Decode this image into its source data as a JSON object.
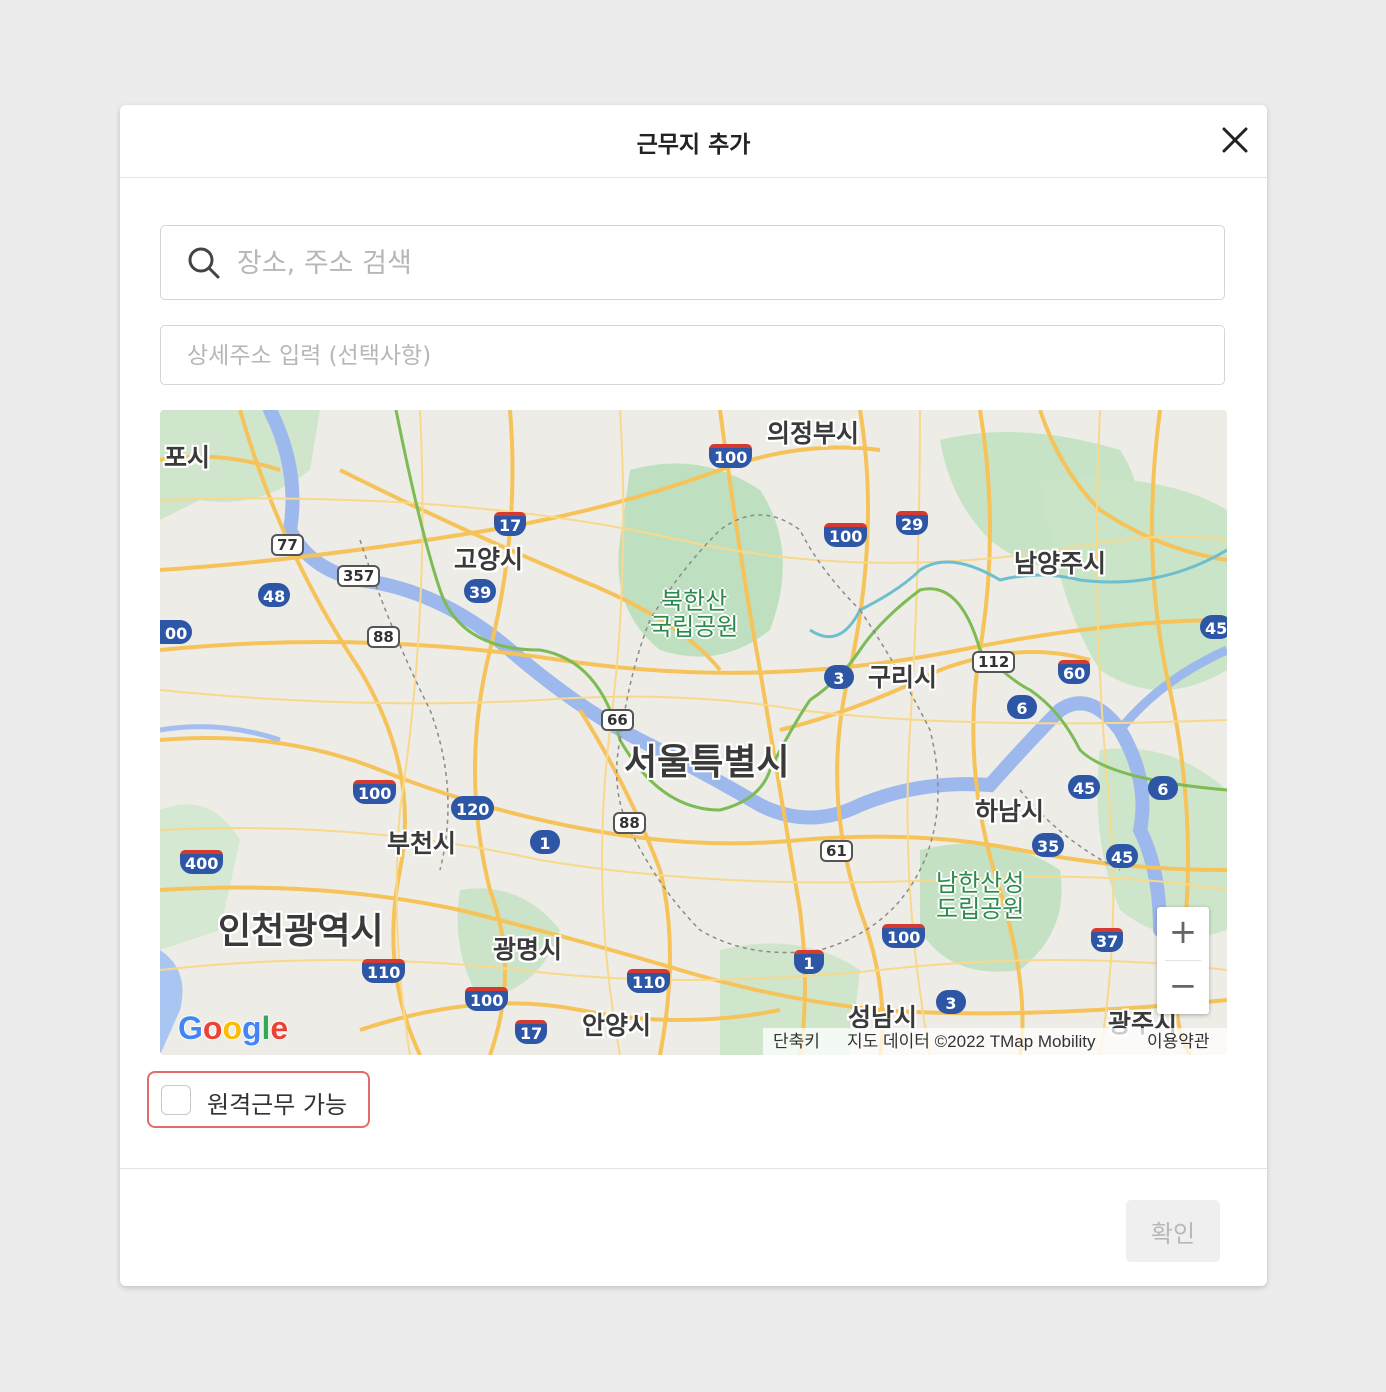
{
  "modal": {
    "title": "근무지 추가",
    "close_icon": "close-icon"
  },
  "search": {
    "icon": "search-icon",
    "placeholder": "장소, 주소 검색",
    "value": ""
  },
  "detail_address": {
    "placeholder": "상세주소 입력 (선택사항)",
    "value": ""
  },
  "map": {
    "cities": {
      "pocheon": "포시",
      "uijeongbu": "의정부시",
      "goyang": "고양시",
      "namyangju": "남양주시",
      "guri": "구리시",
      "seoul": "서울특별시",
      "hanam": "하남시",
      "bucheon": "부천시",
      "incheon": "인천광역시",
      "gwangmyeong": "광명시",
      "anyang": "안양시",
      "seongnam": "성남시",
      "gwangju": "광주시"
    },
    "parks": {
      "bukhansan": "북한산\n국립공원",
      "namhansanseong": "남한산성\n도립공원"
    },
    "shields": [
      "100",
      "17",
      "29",
      "100",
      "39",
      "48",
      "00",
      "45",
      "60",
      "3",
      "6",
      "1",
      "120",
      "100",
      "400",
      "35",
      "45",
      "45",
      "6",
      "100",
      "1",
      "3",
      "110",
      "110",
      "100",
      "17",
      "37"
    ],
    "hex_shields": [
      "77",
      "357",
      "88",
      "112",
      "66",
      "88",
      "61"
    ],
    "zoom_in": "+",
    "zoom_out": "−",
    "google_logo": "Google",
    "attribution": {
      "shortcuts": "단축키",
      "data": "지도 데이터 ©2022 TMap Mobility",
      "terms": "이용약관"
    }
  },
  "remote": {
    "label": "원격근무 가능",
    "checked": false
  },
  "footer": {
    "confirm_label": "확인"
  },
  "colors": {
    "accent_border": "#e36b6b",
    "disabled_bg": "#efefef",
    "disabled_text": "#b8b8b8"
  }
}
